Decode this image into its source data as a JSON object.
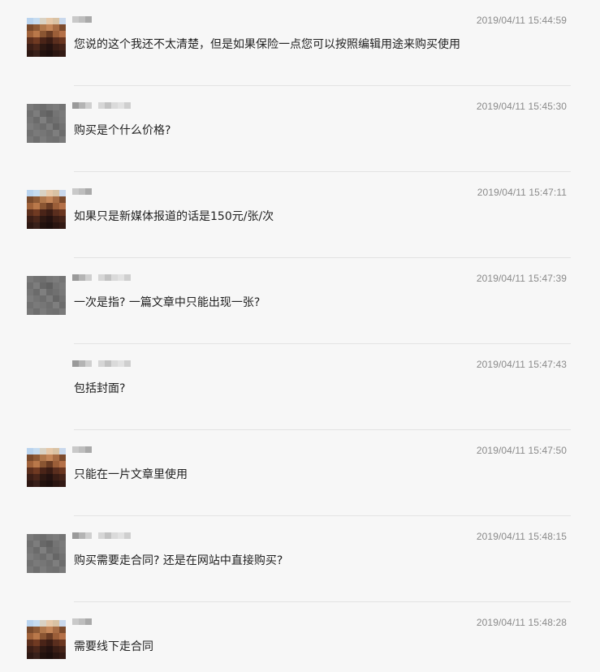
{
  "messages": [
    {
      "avatar": "orange",
      "name_pixels": "short",
      "timestamp": "2019/04/11 15:44:59",
      "text": "您说的这个我还不太清楚，但是如果保险一点您可以按照编辑用途来购买使用"
    },
    {
      "avatar": "gray",
      "name_pixels": "long",
      "timestamp": "2019/04/11 15:45:30",
      "text": "购买是个什么价格?"
    },
    {
      "avatar": "orange",
      "name_pixels": "short",
      "timestamp": "2019/04/11 15:47:11",
      "text": "如果只是新媒体报道的话是150元/张/次"
    },
    {
      "avatar": "gray",
      "name_pixels": "long",
      "timestamp": "2019/04/11 15:47:39",
      "text": "一次是指? 一篇文章中只能出现一张?"
    },
    {
      "avatar": "none",
      "name_pixels": "long",
      "timestamp": "2019/04/11 15:47:43",
      "text": "包括封面?"
    },
    {
      "avatar": "orange",
      "name_pixels": "short",
      "timestamp": "2019/04/11 15:47:50",
      "text": "只能在一片文章里使用"
    },
    {
      "avatar": "gray",
      "name_pixels": "long",
      "timestamp": "2019/04/11 15:48:15",
      "text": "购买需要走合同? 还是在网站中直接购买?"
    },
    {
      "avatar": "orange",
      "name_pixels": "short",
      "timestamp": "2019/04/11 15:48:28",
      "text": "需要线下走合同"
    }
  ]
}
